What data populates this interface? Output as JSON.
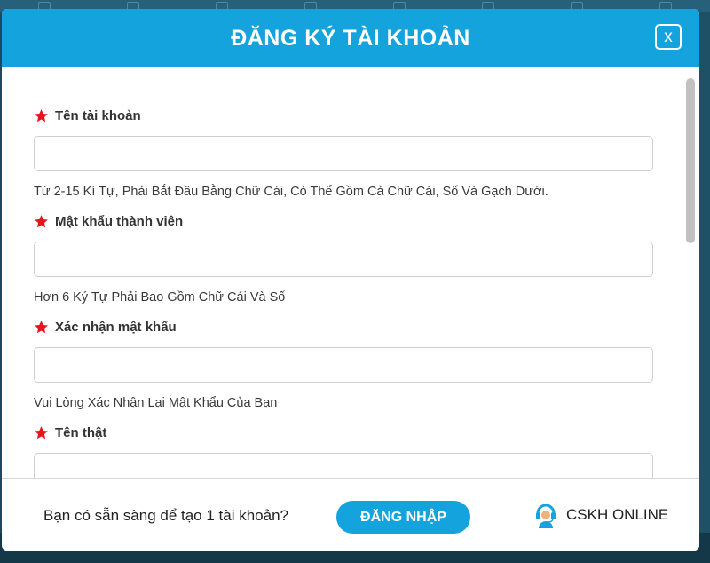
{
  "modal": {
    "title": "ĐĂNG KÝ TÀI KHOẢN",
    "close_label": "x"
  },
  "fields": [
    {
      "label": "Tên tài khoản",
      "value": "",
      "hint": "Từ 2-15 Kí Tự, Phải Bắt Đầu Bằng Chữ Cái, Có Thể Gồm Cả Chữ Cái, Số Và Gạch Dưới."
    },
    {
      "label": "Mật khẩu thành viên",
      "value": "",
      "hint": "Hơn 6 Ký Tự Phải Bao Gồm Chữ Cái Và Số"
    },
    {
      "label": "Xác nhận mật khẩu",
      "value": "",
      "hint": "Vui Lòng Xác Nhận Lại Mật Khẩu Của Bạn"
    },
    {
      "label": "Tên thật",
      "value": ""
    }
  ],
  "footer": {
    "question": "Bạn có sẵn sàng để tạo 1 tài khoản?",
    "login_label": "ĐĂNG NHẬP",
    "support_label": "CSKH ONLINE"
  },
  "colors": {
    "accent": "#14a3dc",
    "required_star": "#e8141b"
  }
}
